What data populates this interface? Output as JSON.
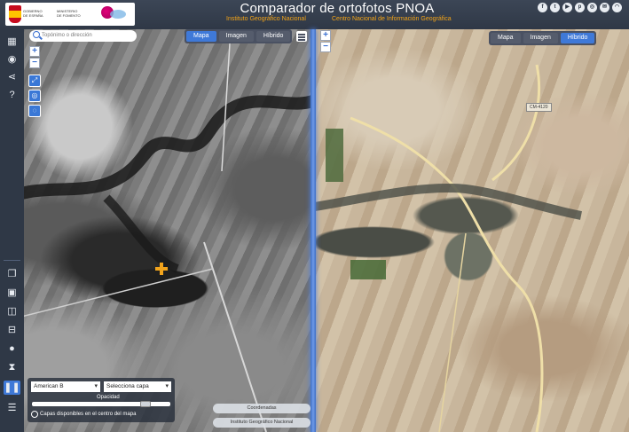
{
  "header": {
    "title": "Comparador de ortofotos PNOA",
    "subtitle_1": "Instituto Geográfico Nacional",
    "subtitle_2": "Centro Nacional de Información Geográfica",
    "logo_text_1": "GOBIERNO\nDE ESPAÑA",
    "logo_text_2": "MINISTERIO\nDE FOMENTO",
    "social_icons": [
      "facebook-icon",
      "twitter-icon",
      "youtube-icon",
      "pinterest-icon",
      "instagram-icon",
      "email-icon",
      "rss-icon"
    ]
  },
  "search": {
    "placeholder": "Topónimo o dirección"
  },
  "left_map": {
    "tabs": [
      "Mapa",
      "Imagen",
      "Híbrido"
    ],
    "active_tab": "Mapa"
  },
  "right_map": {
    "tabs": [
      "Mapa",
      "Imagen",
      "Híbrido"
    ],
    "active_tab": "Híbrido",
    "road_label": "CM-4120"
  },
  "layer_panel": {
    "selected_layer": "American B",
    "second_select": "Selecciona capa",
    "opacity_label": "Opacidad",
    "opacity_value": 0.85,
    "layers_info": "Capas disponibles en el centro del mapa"
  },
  "footer": {
    "coordinates_label": "Coordenadas",
    "attribution": "Instituto Geográfico Nacional"
  },
  "colors": {
    "accent": "#3f79d8",
    "header_bg": "#2f3846",
    "title_orange": "#f4a417",
    "marker": "#f2a41c"
  }
}
